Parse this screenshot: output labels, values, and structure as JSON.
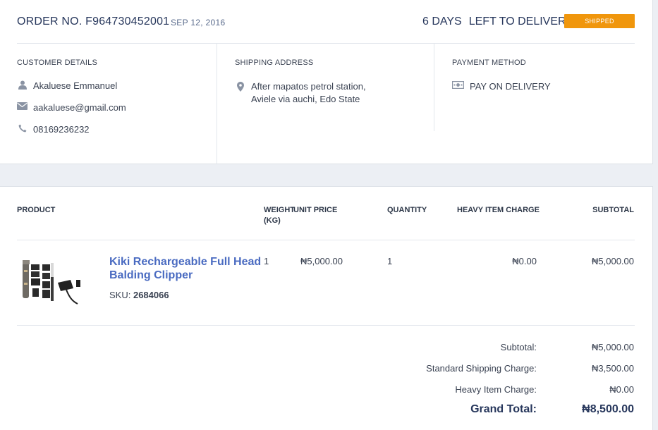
{
  "order": {
    "number_label": "ORDER NO. F964730452001",
    "date": "SEP 12, 2016",
    "days_count": "6 DAYS",
    "days_text": "LEFT TO DELIVER",
    "status": "SHIPPED",
    "status_color": "#f0960c"
  },
  "customer": {
    "heading": "CUSTOMER DETAILS",
    "name": "Akaluese Emmanuel",
    "email": "aakaluese@gmail.com",
    "phone": "08169236232"
  },
  "shipping": {
    "heading": "SHIPPING ADDRESS",
    "address_line1": "After mapatos petrol station,",
    "address_line2": "Aviele via auchi, Edo State"
  },
  "payment": {
    "heading": "PAYMENT METHOD",
    "method": "PAY ON DELIVERY"
  },
  "table": {
    "headers": {
      "product": "PRODUCT",
      "weight_line1": "WEIGHT",
      "weight_line2": "(KG)",
      "unit_price": "UNIT PRICE",
      "quantity": "QUANTITY",
      "heavy_charge": "HEAVY ITEM CHARGE",
      "subtotal": "SUBTOTAL"
    },
    "items": [
      {
        "name": "Kiki Rechargeable Full Head Balding Clipper",
        "sku_label": "SKU:",
        "sku": "2684066",
        "weight": "1",
        "unit_price": "₦5,000.00",
        "quantity": "1",
        "heavy_charge": "₦0.00",
        "subtotal": "₦5,000.00"
      }
    ]
  },
  "totals": {
    "subtotal_label": "Subtotal:",
    "subtotal": "₦5,000.00",
    "shipping_label": "Standard Shipping Charge:",
    "shipping": "₦3,500.00",
    "heavy_label": "Heavy Item Charge:",
    "heavy": "₦0.00",
    "grand_label": "Grand Total:",
    "grand": "₦8,500.00"
  },
  "icons": {
    "name": "user-icon",
    "email": "envelope-icon",
    "phone": "phone-icon",
    "address": "map-pin-icon",
    "payment": "cash-icon"
  }
}
